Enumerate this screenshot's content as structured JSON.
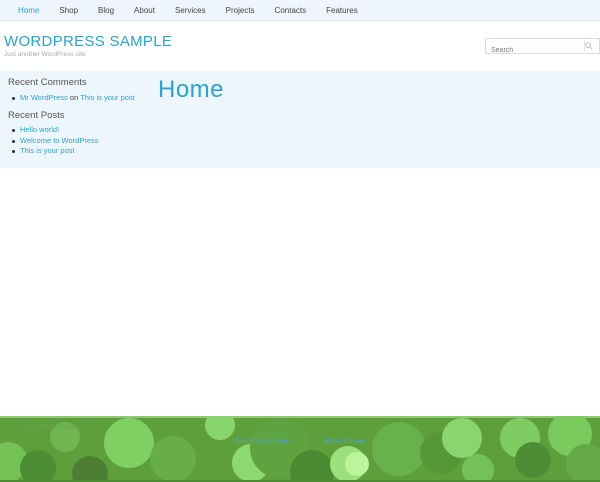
{
  "nav": {
    "items": [
      {
        "label": "Home",
        "active": true
      },
      {
        "label": "Shop"
      },
      {
        "label": "Blog"
      },
      {
        "label": "About"
      },
      {
        "label": "Services"
      },
      {
        "label": "Projects"
      },
      {
        "label": "Contacts"
      },
      {
        "label": "Features"
      }
    ]
  },
  "site": {
    "title": "WORDPRESS SAMPLE",
    "tagline": "Just another WordPress site"
  },
  "search": {
    "placeholder": "Search",
    "icon": "search-icon"
  },
  "sidebar": {
    "recent_comments_title": "Recent Comments",
    "comment": {
      "author": "Mr WordPress",
      "on": "on",
      "post": "This is your post"
    },
    "recent_posts_title": "Recent Posts",
    "posts": [
      "Hello world!",
      "Welcome to WordPress",
      "This is your post"
    ]
  },
  "main": {
    "page_title": "Home"
  },
  "footer": {
    "copyright": "© 2016 Billion Themes",
    "theme_link": "WordPress Theme",
    "author_link": "Billion Themes"
  },
  "colors": {
    "accent": "#2aa3cf",
    "nav_bg": "#eef5fc",
    "content_bg": "#eef6fd",
    "footer_green": "#5e9f3c"
  }
}
